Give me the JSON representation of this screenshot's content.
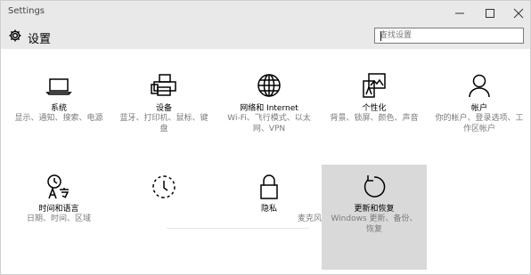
{
  "window": {
    "title": "Settings"
  },
  "header": {
    "title": "设置"
  },
  "search": {
    "placeholder": "查找设置"
  },
  "tiles": [
    {
      "label": "系统",
      "desc": "显示、通知、搜索、电源",
      "icon": "laptop-icon"
    },
    {
      "label": "设备",
      "desc": "蓝牙、打印机、鼠标、键盘",
      "icon": "printer-icon"
    },
    {
      "label": "网络和 Internet",
      "desc": "Wi-Fi、飞行模式、以太网、VPN",
      "icon": "globe-icon"
    },
    {
      "label": "个性化",
      "desc": "背景、锁屏、颜色、声音",
      "icon": "personalize-icon"
    },
    {
      "label": "帐户",
      "desc": "你的帐户、登录选项、工作区帐户",
      "icon": "person-icon"
    },
    {
      "label": "时间和语言",
      "desc": "日期、时间、区域",
      "icon": "time-language-icon"
    },
    {
      "label": "",
      "desc": "",
      "icon": "ease-of-access-icon"
    },
    {
      "label": "隐私",
      "desc": "麦克风",
      "icon": "lock-icon"
    },
    {
      "label": "更新和恢复",
      "desc": "Windows 更新、备份、恢复",
      "icon": "refresh-icon"
    }
  ]
}
